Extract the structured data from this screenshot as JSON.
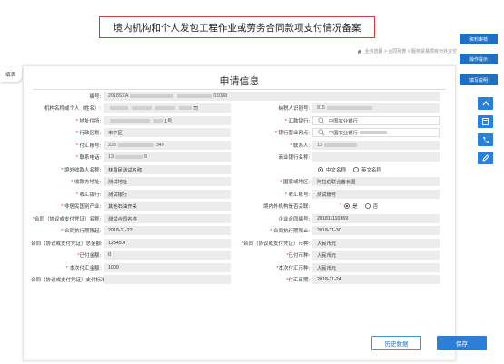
{
  "banner_title": "境内机构和个人发包工程作业或劳务合同款项支付情况备案",
  "breadcrumb": "业务选择 > 合同列表 > 服务贸易项目对外支付",
  "side_buttons": [
    "资料审核",
    "操作提示",
    "填写说明"
  ],
  "tab_label": "填表",
  "form_title": "申请信息",
  "radio_options": {
    "name_cn": "中文名称",
    "name_en": "英文名称",
    "yes": "是",
    "no": "否"
  },
  "fields": {
    "serial_label": "编号:",
    "serial_value": "2018SXA",
    "serial_tail": "01098",
    "org_label": "机构名称或个人（姓名）:",
    "org_value_tail": "司",
    "taxid_label": "纳税人识别号:",
    "taxid_value": "915",
    "addr_label": "地址住所:",
    "addr_value_tail": "1号",
    "bank_label": "汇款银行:",
    "bank_value": "中国农业银行",
    "district_label": "行政区划:",
    "district_value": "市中区",
    "branch_label": "银行营业网点:",
    "branch_value": "中国农业银行",
    "acct_label": "付汇账号:",
    "acct_value": "223",
    "acct_tail": "349",
    "contact_label": "联系人:",
    "contact_value": "13",
    "phone_label": "联系电话:",
    "phone_value": "13",
    "phone_tail": "9",
    "biz_label": "商业银行名称:",
    "biz_value": "",
    "payee_label": "境外收款人名称:",
    "payee_value": "林恩民测试名称",
    "recv_addr_label": "收款方地址:",
    "recv_addr_value": "测试地址",
    "country_label": "国家或地区:",
    "country_value": "阿拉伯联合酋长国",
    "recv_bank_label": "收汇银行:",
    "recv_bank_value": "测试银行",
    "recv_acct_label": "收汇账号:",
    "recv_acct_value": "测试账号",
    "nonres_label": "非居民国别产业:",
    "nonres_value": "其他石油开采",
    "related_label": "境内外机构是否关联:",
    "contract_name_label": "合同（协议或支付凭证）名称:",
    "contract_name_value": "测试合同名称",
    "contract_no_label": "企业合同编号:",
    "contract_no_value": "201811110369",
    "start_label": "合同执行期限起:",
    "start_value": "2018-11-22",
    "end_label": "合同执行期限止:",
    "end_value": "2018-11-30",
    "total_label": "合同（协议或支付凭证）总金额:",
    "total_value": "12345.0",
    "total_cur_label": "合同（协议或支付凭证）币种:",
    "total_cur_value": "人民币元",
    "paid_label": "已付金额:",
    "paid_value": "0",
    "paid_cur_label": "已付币种:",
    "paid_cur_value": "人民币元",
    "this_label": "本次付汇金额:",
    "this_value": "1000",
    "this_cur_label": "本次付汇币种:",
    "this_cur_value": "人民币元",
    "std_label": "合同（协议或支付凭证）支付标准:",
    "std_value": "",
    "pay_date_label": "付汇日期:",
    "pay_date_value": "2018-11-24"
  },
  "buttons": {
    "history": "历史数据",
    "save": "保存"
  },
  "colors": {
    "accent": "#2a80d8",
    "required": "#e23333",
    "banner_border": "#d63b3b"
  }
}
